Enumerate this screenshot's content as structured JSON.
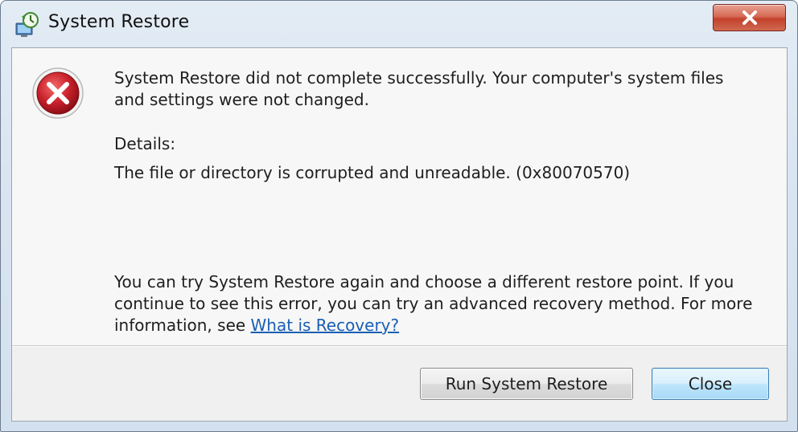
{
  "window": {
    "title": "System Restore"
  },
  "message": {
    "main": "System Restore did not complete successfully. Your computer's system files and settings were not changed.",
    "details_label": "Details:",
    "details_text": "The file or directory is corrupted and unreadable. (0x80070570)",
    "hint_text": "You can try System Restore again and choose a different restore point.  If you continue to see this error, you can try an advanced recovery method. For more information, see ",
    "link_text": "What is Recovery?"
  },
  "buttons": {
    "run_label": "Run System Restore",
    "close_label": "Close"
  },
  "icons": {
    "app": "system-restore-icon",
    "error": "error-icon",
    "close": "close-icon"
  },
  "colors": {
    "error_red": "#c8202a",
    "link": "#1a5fb4",
    "titlebar": "#dbe6f2"
  }
}
